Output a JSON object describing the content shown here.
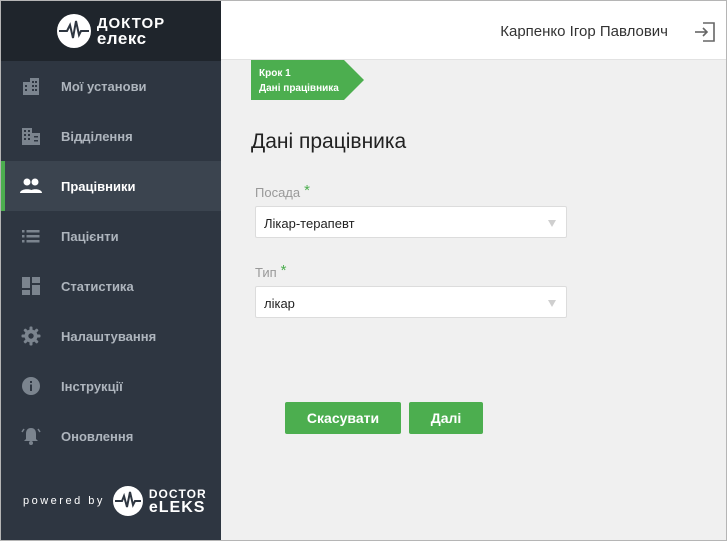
{
  "brand": {
    "logo_line1": "ДОКТОР",
    "logo_line2": "елекс",
    "powered_by": "powered by",
    "powered_line1": "DOCTOR",
    "powered_line2": "eLEKS",
    "accent_color": "#4cae4f"
  },
  "sidebar": {
    "items": [
      {
        "label": "Мої установи",
        "icon": "building-icon",
        "active": false
      },
      {
        "label": "Відділення",
        "icon": "office-icon",
        "active": false
      },
      {
        "label": "Працівники",
        "icon": "people-icon",
        "active": true
      },
      {
        "label": "Пацієнти",
        "icon": "list-icon",
        "active": false
      },
      {
        "label": "Статистика",
        "icon": "dashboard-icon",
        "active": false
      },
      {
        "label": "Налаштування",
        "icon": "gear-icon",
        "active": false
      },
      {
        "label": "Інструкції",
        "icon": "info-icon",
        "active": false
      },
      {
        "label": "Оновлення",
        "icon": "bell-icon",
        "active": false
      }
    ]
  },
  "header": {
    "user_name": "Карпенко Ігор Павлович",
    "logout_icon": "logout-icon"
  },
  "step": {
    "title": "Крок 1",
    "subtitle": "Дані працівника"
  },
  "form": {
    "title": "Дані працівника",
    "position_label": "Посада",
    "position_value": "Лікар-терапевт",
    "type_label": "Тип",
    "type_value": "лікар",
    "required_mark": "*"
  },
  "buttons": {
    "cancel": "Скасувати",
    "next": "Далі"
  }
}
